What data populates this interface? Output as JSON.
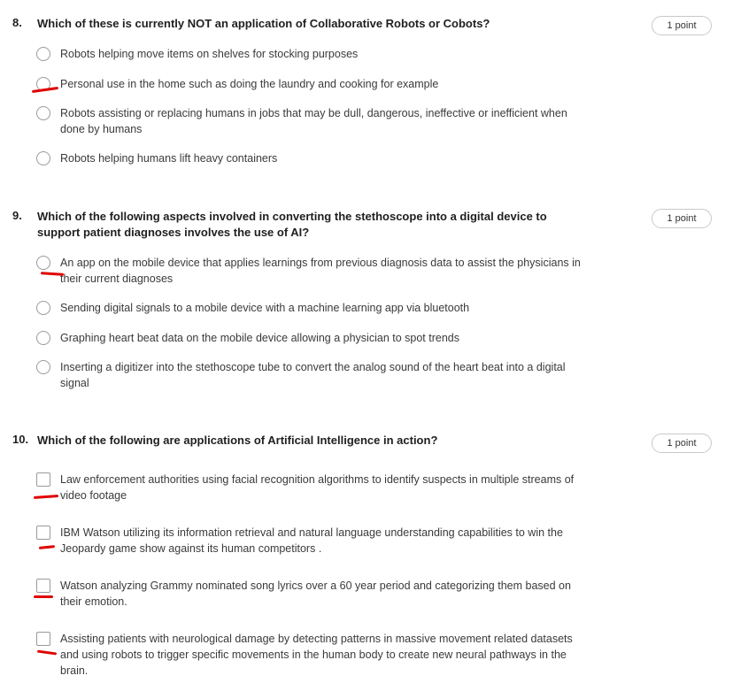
{
  "questions": [
    {
      "number": "8.",
      "text": "Which of these is currently NOT an application of Collaborative Robots or Cobots?",
      "points": "1 point",
      "type": "radio",
      "options": [
        "Robots helping move items on shelves for stocking purposes",
        "Personal use in the home such as doing the laundry and cooking for example",
        "Robots assisting or replacing humans in jobs that may be dull, dangerous, ineffective or inefficient when done by humans",
        "Robots helping humans lift heavy containers"
      ]
    },
    {
      "number": "9.",
      "text": "Which of the following aspects involved in converting the stethoscope into a digital device to support patient diagnoses involves the use of AI?",
      "points": "1 point",
      "type": "radio",
      "options": [
        "An app on the mobile device that applies learnings from previous diagnosis data to assist the physicians in their current diagnoses",
        "Sending digital signals to a mobile device with a machine learning app via bluetooth",
        "Graphing heart beat data on the mobile device allowing a physician to spot trends",
        "Inserting a digitizer into the stethoscope tube to convert the analog sound of the heart beat into a digital signal"
      ]
    },
    {
      "number": "10.",
      "text": "Which of the following are applications of Artificial Intelligence in action?",
      "points": "1 point",
      "type": "checkbox",
      "options": [
        "Law enforcement authorities using facial recognition algorithms to identify suspects in multiple streams of video footage",
        "IBM Watson utilizing its information retrieval and natural language understanding capabilities to win the Jeopardy game show against its human competitors .",
        "Watson analyzing Grammy nominated song lyrics over a 60 year period and categorizing them based on their emotion.",
        "Assisting patients with neurological damage by detecting patterns in massive movement related datasets and using robots to trigger specific movements in the human body to create new neural pathways in the brain."
      ]
    }
  ],
  "annotation_color": "#e00000"
}
